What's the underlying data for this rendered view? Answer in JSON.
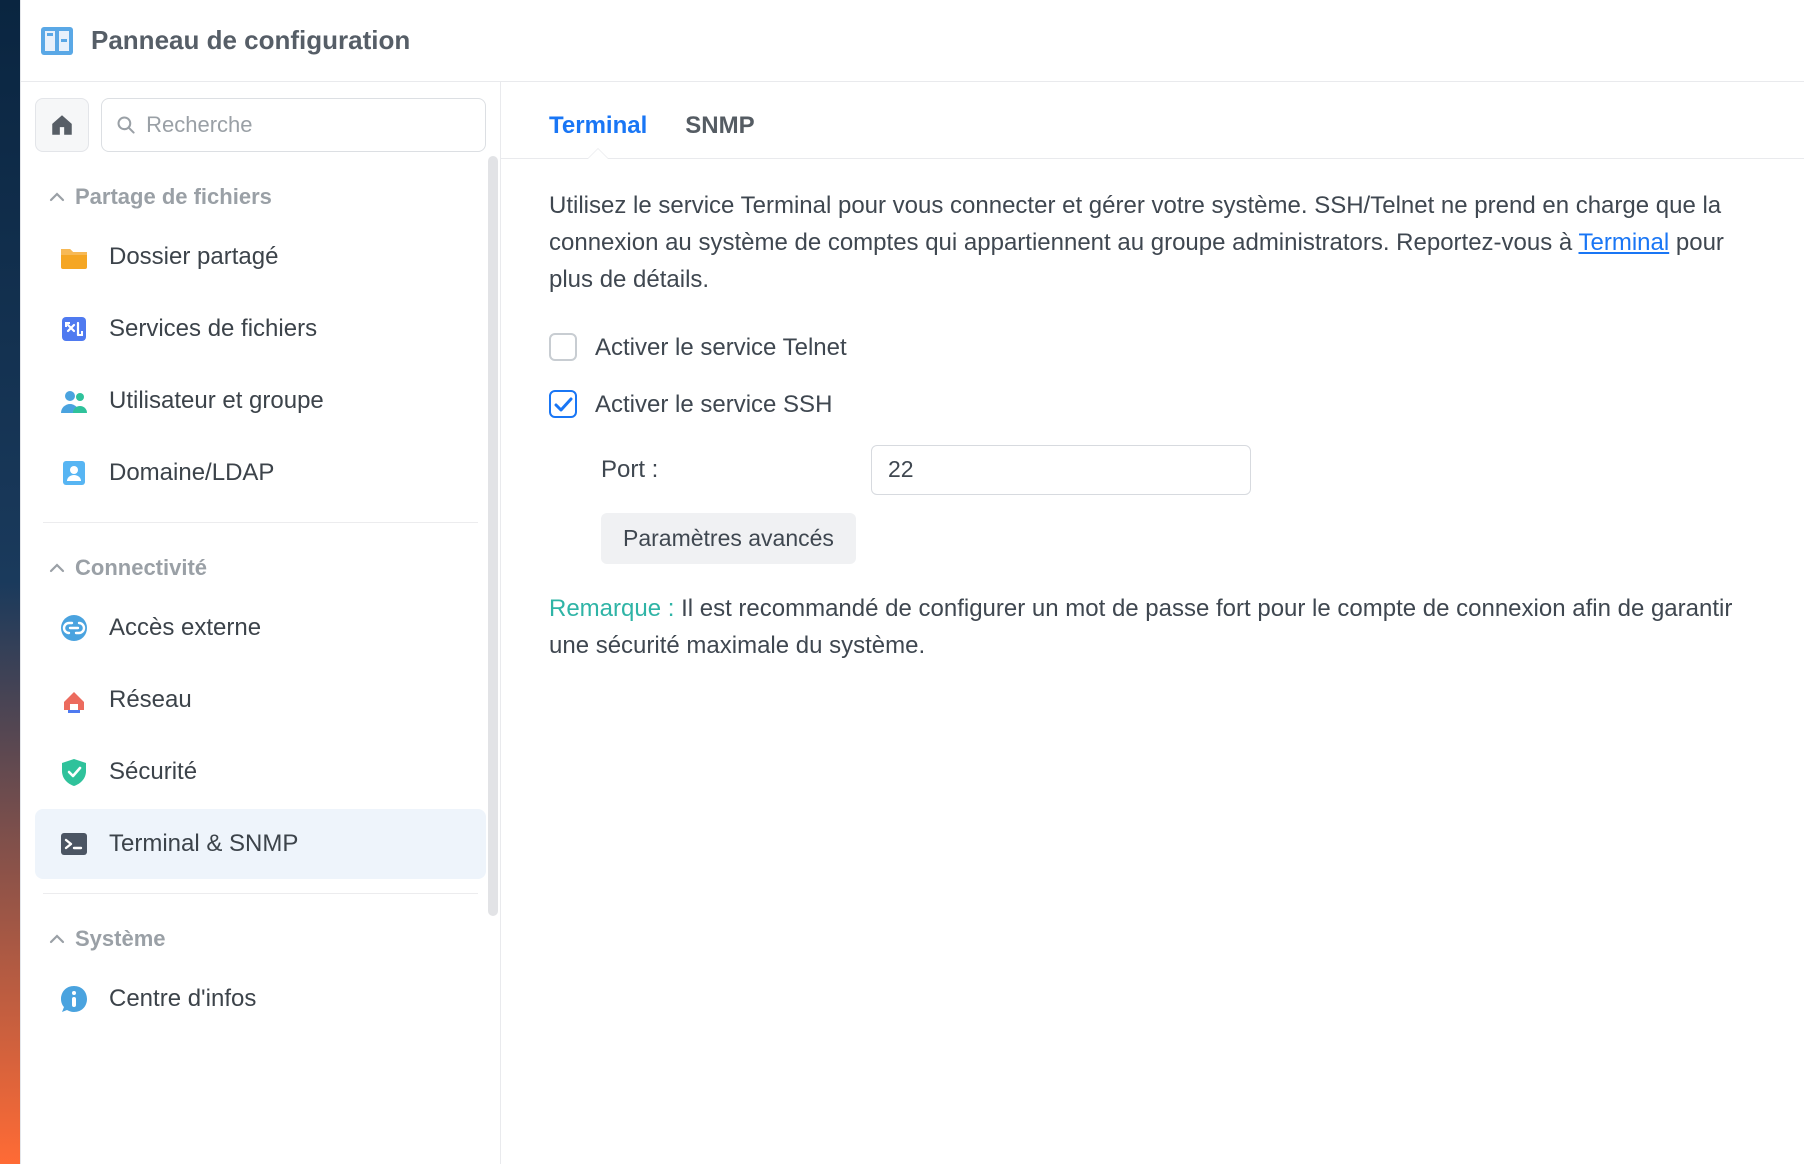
{
  "window_title": "Panneau de configuration",
  "search": {
    "placeholder": "Recherche"
  },
  "sidebar": {
    "sections": [
      {
        "label": "Partage de fichiers",
        "items": [
          {
            "label": "Dossier partagé"
          },
          {
            "label": "Services de fichiers"
          },
          {
            "label": "Utilisateur et groupe"
          },
          {
            "label": "Domaine/LDAP"
          }
        ]
      },
      {
        "label": "Connectivité",
        "items": [
          {
            "label": "Accès externe"
          },
          {
            "label": "Réseau"
          },
          {
            "label": "Sécurité"
          },
          {
            "label": "Terminal & SNMP"
          }
        ]
      },
      {
        "label": "Système",
        "items": [
          {
            "label": "Centre d'infos"
          }
        ]
      }
    ]
  },
  "tabs": [
    {
      "label": "Terminal",
      "active": true
    },
    {
      "label": "SNMP",
      "active": false
    }
  ],
  "terminal": {
    "description_pre": "Utilisez le service Terminal pour vous connecter et gérer votre système. SSH/Telnet ne prend en charge que la connexion au système de comptes qui appartiennent au groupe administrators. Reportez-vous à ",
    "description_link": "Terminal",
    "description_post": " pour plus de détails.",
    "telnet_label": "Activer le service Telnet",
    "telnet_checked": false,
    "ssh_label": "Activer le service SSH",
    "ssh_checked": true,
    "port_label": "Port :",
    "port_value": "22",
    "advanced_button": "Paramètres avancés",
    "note_label": "Remarque : ",
    "note_text": "Il est recommandé de configurer un mot de passe fort pour le compte de connexion afin de garantir une sécurité maximale du système."
  }
}
